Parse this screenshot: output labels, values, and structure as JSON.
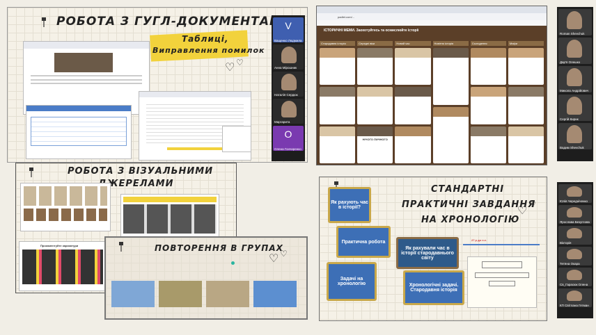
{
  "panel_google": {
    "title": "РОБОТА З ГУГЛ-ДОКУМЕНТАМИ",
    "subtitle_1": "Таблиці,",
    "subtitle_2": "Виправлення помилок"
  },
  "panel_visual": {
    "title_1": "РОБОТА З ВІЗУАЛЬНИМИ",
    "title_2": "ДЖЕРЕЛАМИ",
    "caricature_label": "Прокоментуйте карикатури"
  },
  "panel_repeat": {
    "title": "ПОВТОРЕННЯ В ГРУПАХ"
  },
  "panel_padlet": {
    "board_title": "ІСТОРИЧНІ МЕМИ. Заохотуйтесь та осмислюйте історії",
    "columns": [
      "Стародавня історія",
      "Середні віки",
      "Новий час",
      "Новітня історія",
      "Сьогодення",
      "Мифи"
    ],
    "poster_caption": "НІЧОГО ЛИЧНОГО",
    "url": "padlet.com/..."
  },
  "panel_standard": {
    "title_1": "СТАНДАРТНІ",
    "title_2": "ПРАКТИЧНІ ЗАВДАННЯ",
    "title_3": "НА ХРОНОЛОГІЮ",
    "card_1": "Як рахують час в історії?",
    "card_2": "Практична робота",
    "card_3": "Задачі на хронологію",
    "card_4": "Як рахували час в історії стародавнього світу",
    "card_5": "Хронологічні задачі. Стародавня історія",
    "timeline_label": "27 р до н.е."
  },
  "participants_top": [
    {
      "name": "Ващенко Людмила",
      "initial": "V",
      "color": "#3f5fb0"
    },
    {
      "name": "Анна Мірошник",
      "initial": "",
      "color": "#2b2b2b"
    },
    {
      "name": "Наталія Сердюк",
      "initial": "",
      "color": "#2b2b2b"
    },
    {
      "name": "Маргарита",
      "initial": "",
      "color": "#2b2b2b"
    },
    {
      "name": "Олена Гончаренко",
      "initial": "O",
      "color": "#7a3ab0"
    }
  ],
  "participants_right_top": [
    {
      "name": "Roman Shevchuk"
    },
    {
      "name": "Дар'я Олешко"
    },
    {
      "name": "Микола Андрійович"
    },
    {
      "name": "Сергій Кирик"
    },
    {
      "name": "Вадим Shevchuk"
    }
  ],
  "participants_right_bottom": [
    {
      "name": "Юлія Чередніченко"
    },
    {
      "name": "Ярослава Безуглова"
    },
    {
      "name": "Вікторія"
    },
    {
      "name": "Тетяна Окара"
    },
    {
      "name": "Св_Гарасюк Олена"
    },
    {
      "name": "КП Світлана Гетман"
    }
  ]
}
